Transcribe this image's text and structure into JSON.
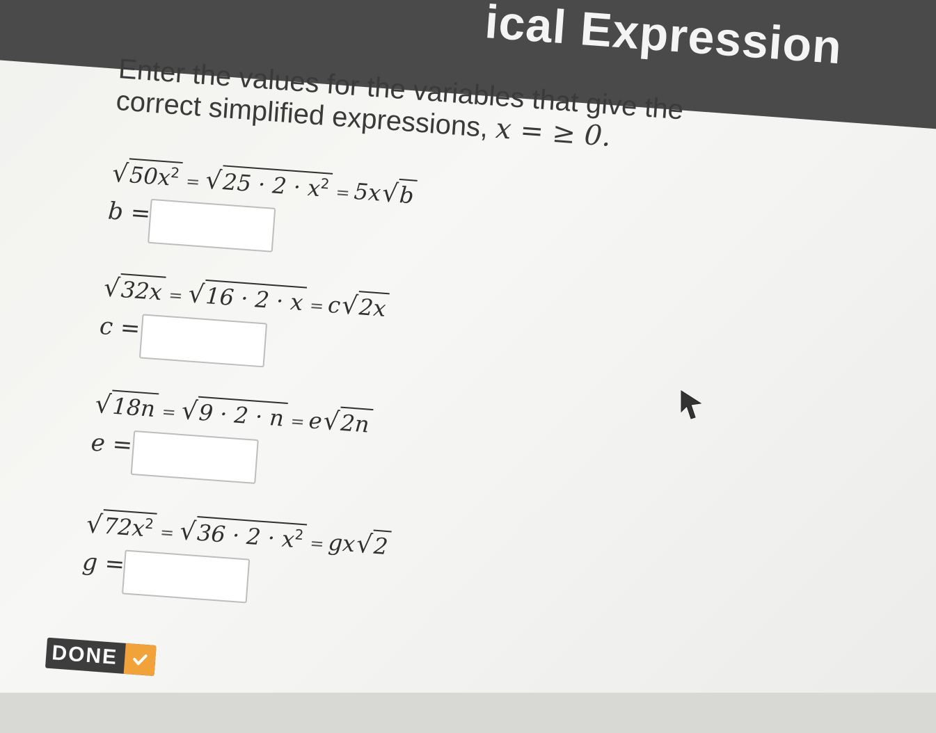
{
  "header": {
    "title": "ical Expression"
  },
  "instructions": {
    "text": "Enter the values for the variables that give the correct simplified expressions,",
    "condition": "x = ≥ 0."
  },
  "equations": [
    {
      "lhs_radicand": "50x",
      "lhs_exp": "2",
      "mid_radicand": "25 · 2 · x",
      "mid_exp": "2",
      "rhs_coef": "5x",
      "rhs_radicand": "b",
      "label": "b =",
      "value": ""
    },
    {
      "lhs_radicand": "32x",
      "mid_radicand": "16 · 2 · x",
      "rhs_coef": "c",
      "rhs_radicand": "2x",
      "label": "c =",
      "value": ""
    },
    {
      "lhs_radicand": "18n",
      "mid_radicand": "9 · 2 · n",
      "rhs_coef": "e",
      "rhs_radicand": "2n",
      "label": "e =",
      "value": ""
    },
    {
      "lhs_radicand": "72x",
      "lhs_exp": "2",
      "mid_radicand": "36 · 2 · x",
      "mid_exp": "2",
      "rhs_coef": "gx",
      "rhs_radicand": "2",
      "label": "g =",
      "value": ""
    }
  ],
  "symbols": {
    "equals": "=",
    "radical": "√"
  },
  "done_button": {
    "label": "DONE"
  },
  "colors": {
    "header": "#4a4a4a",
    "accent": "#f2a23a",
    "background": "#f4f4f2"
  },
  "icons": {
    "back": "back-arrow-icon",
    "check": "check-icon",
    "cursor": "mouse-pointer-icon"
  }
}
